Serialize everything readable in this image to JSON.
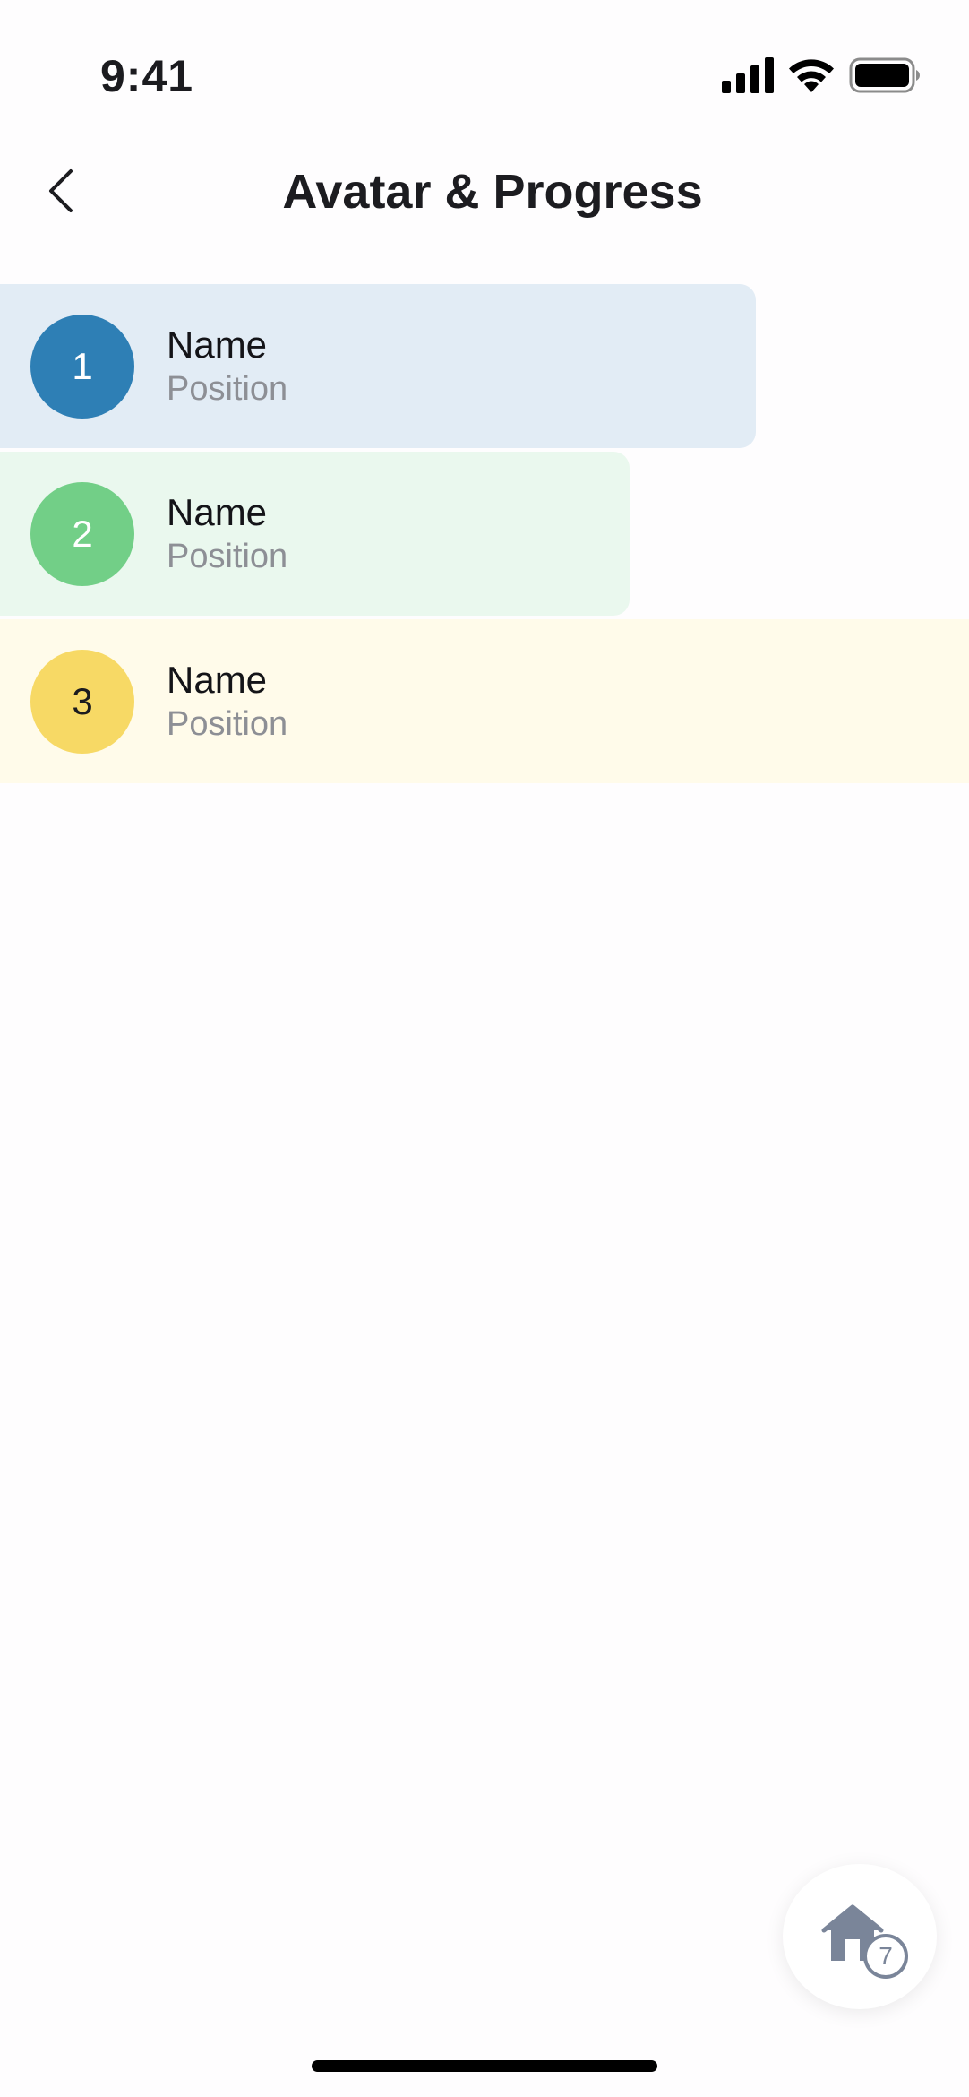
{
  "status_bar": {
    "time": "9:41",
    "icons": [
      "signal-icon",
      "wifi-icon",
      "battery-icon"
    ]
  },
  "header": {
    "title": "Avatar & Progress",
    "back_icon": "chevron-left-icon"
  },
  "people": [
    {
      "number": "1",
      "name": "Name",
      "position": "Position",
      "progress_percent": 78,
      "avatar_color": "#2e7fb5",
      "avatar_text_color": "#ffffff",
      "track_color": "#e2ecf5"
    },
    {
      "number": "2",
      "name": "Name",
      "position": "Position",
      "progress_percent": 65,
      "avatar_color": "#72cf87",
      "avatar_text_color": "#ffffff",
      "track_color": "#eaf8ee"
    },
    {
      "number": "3",
      "name": "Name",
      "position": "Position",
      "progress_percent": 100,
      "avatar_color": "#f7d965",
      "avatar_text_color": "#1b1b1f",
      "track_color": "#fffbea"
    }
  ],
  "home_button": {
    "icon": "home-icon",
    "badge_count": "7",
    "icon_color": "#7a8599"
  }
}
